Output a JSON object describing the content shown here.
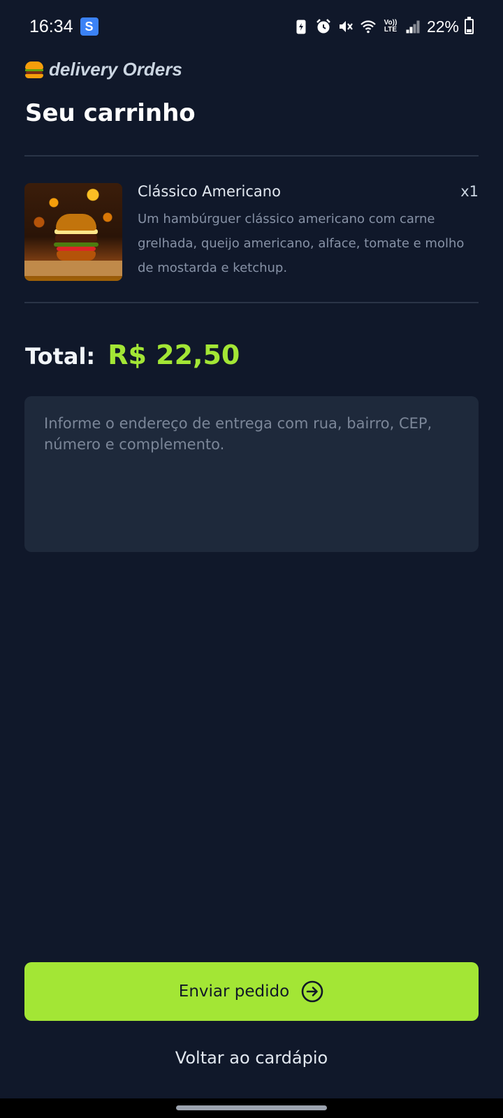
{
  "status_bar": {
    "time": "16:34",
    "app_badge": "S",
    "battery": "22%",
    "volte_line1": "Vo))",
    "volte_line2": "LTE",
    "icons": [
      "battery-saver-icon",
      "alarm-icon",
      "mute-icon",
      "wifi-icon",
      "volte-icon",
      "signal-icon",
      "battery-icon"
    ]
  },
  "header": {
    "brand": "delivery Orders",
    "brand_icon": "burger-emoji-icon",
    "title": "Seu carrinho"
  },
  "cart": {
    "items": [
      {
        "name": "Clássico Americano",
        "quantity": "x1",
        "description": "Um hambúrguer clássico americano com carne grelhada, queijo americano, alface, tomate e molho de mostarda e ketchup.",
        "image": "burger-photo"
      }
    ]
  },
  "total": {
    "label": "Total:",
    "value": "R$ 22,50"
  },
  "address": {
    "value": "",
    "placeholder": "Informe o endereço de entrega com rua, bairro, CEP, número e complemento."
  },
  "actions": {
    "send_label": "Enviar pedido",
    "send_icon": "arrow-right-circle-icon",
    "back_label": "Voltar ao cardápio"
  },
  "colors": {
    "background": "#10182a",
    "accent": "#a3e635",
    "surface": "#1e293b"
  }
}
